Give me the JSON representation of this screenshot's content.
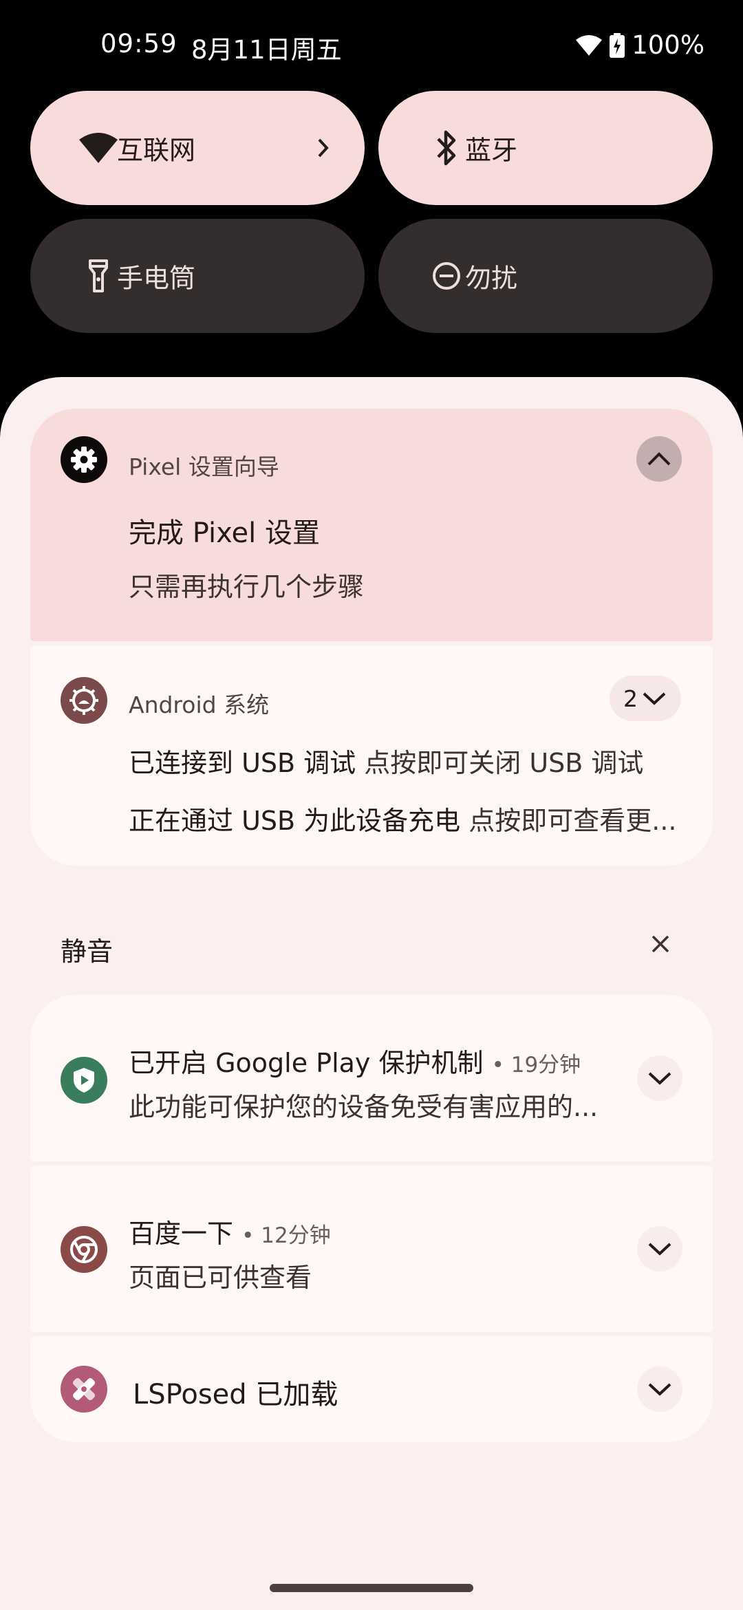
{
  "status_bar": {
    "time": "09:59",
    "date": "8月11日周五",
    "battery": "100%"
  },
  "quick_tiles": [
    {
      "label": "互联网",
      "icon": "wifi-icon",
      "state": "on",
      "has_chevron": true
    },
    {
      "label": "蓝牙",
      "icon": "bluetooth-icon",
      "state": "on"
    },
    {
      "label": "手电筒",
      "icon": "flashlight-icon",
      "state": "off"
    },
    {
      "label": "勿扰",
      "icon": "do-not-disturb-icon",
      "state": "off"
    }
  ],
  "notifications": {
    "pixel_setup": {
      "app_name": "Pixel 设置向导",
      "title": "完成 Pixel 设置",
      "text": "只需再执行几个步骤",
      "icon": "gear-icon"
    },
    "android_system": {
      "app_name": "Android 系统",
      "count": "2",
      "icon": "android-system-icon",
      "line1_title": "已连接到 USB 调试",
      "line1_text": "点按即可关闭 USB 调试",
      "line2_title": "正在通过 USB 为此设备充电",
      "line2_text": "点按即可查看更..."
    }
  },
  "silent_section": {
    "header": "静音",
    "items": [
      {
        "title": "已开启 Google Play 保护机制",
        "time": "19分钟",
        "text": "此功能可保护您的设备免受有害应用的...",
        "icon": "play-protect-icon",
        "icon_color": "#3a7d5c"
      },
      {
        "title": "百度一下",
        "time": "12分钟",
        "text": "页面已可供查看",
        "icon": "chrome-icon",
        "icon_color": "#8a4a4a"
      },
      {
        "title": "LSPosed 已加载",
        "icon": "lsposed-icon",
        "icon_color": "#b25a78"
      }
    ]
  },
  "colors": {
    "tile_on": "#f8dcdc",
    "tile_off": "#332d2d",
    "shade_bg": "#fcefef",
    "card_bg": "#fff8f7"
  }
}
